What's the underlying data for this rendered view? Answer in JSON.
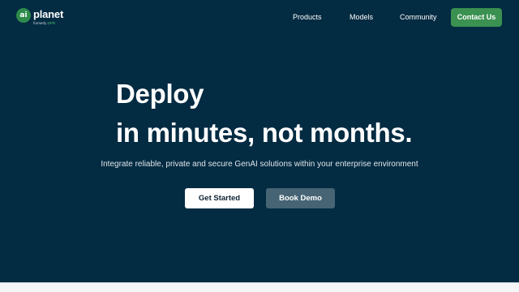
{
  "brand": {
    "logo_mark": "ai",
    "name": "planet",
    "tagline_prefix": "formerly ",
    "tagline_highlight": "DPhi",
    "mark_color": "#2e8b4a"
  },
  "nav": {
    "items": [
      {
        "label": "Products"
      },
      {
        "label": "Models"
      },
      {
        "label": "Community"
      }
    ],
    "contact_label": "Contact Us",
    "contact_color": "#3a9150"
  },
  "hero": {
    "line1": "Deploy",
    "line2": "in minutes, not months.",
    "subtitle": "Integrate reliable, private and secure GenAI solutions within your enterprise environment",
    "primary_cta": "Get Started",
    "secondary_cta": "Book Demo"
  },
  "colors": {
    "background": "#032b42",
    "secondary_button": "#466474"
  }
}
